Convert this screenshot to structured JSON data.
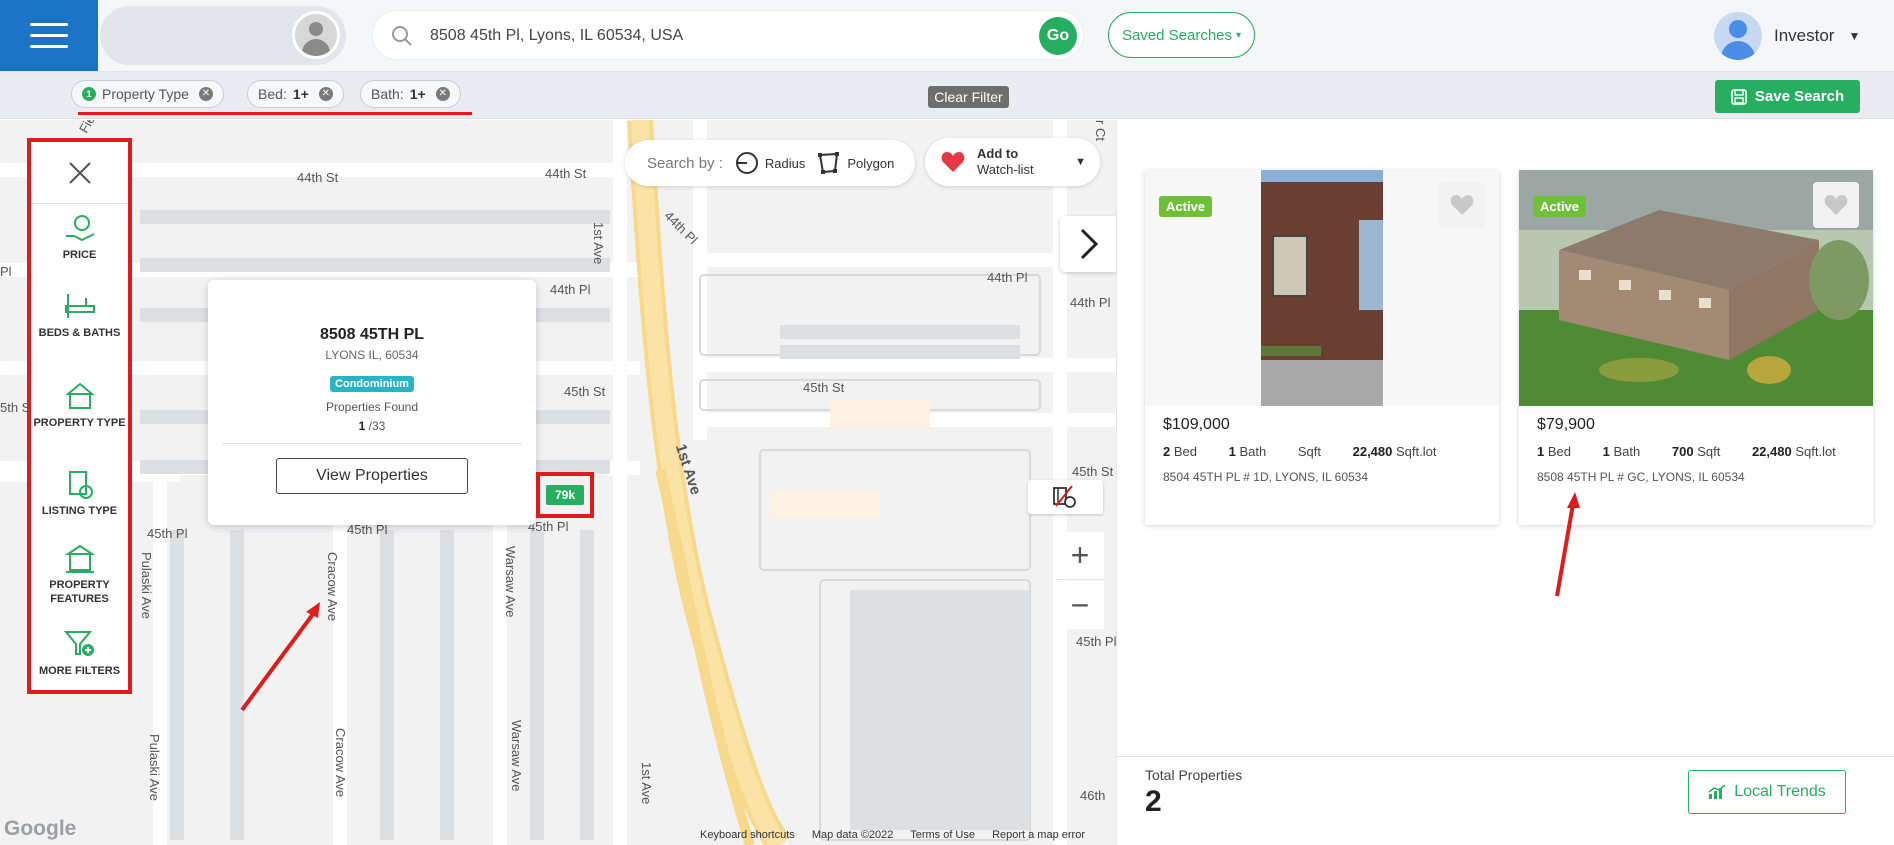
{
  "header": {
    "search_value": "8508 45th Pl, Lyons, IL 60534, USA",
    "go_label": "Go",
    "saved_searches_label": "Saved Searches",
    "user_name": "Investor"
  },
  "filters": {
    "chips": [
      {
        "badge": "1",
        "label": "Property Type",
        "value": ""
      },
      {
        "badge": "",
        "label": "Bed:",
        "value": "1+"
      },
      {
        "badge": "",
        "label": "Bath:",
        "value": "1+"
      }
    ],
    "clear_filter_label": "Clear Filter",
    "save_search_label": "Save Search"
  },
  "map": {
    "search_by_label": "Search by :",
    "radius_label": "Radius",
    "polygon_label": "Polygon",
    "watchlist_line1": "Add to",
    "watchlist_line2": "Watch-list",
    "street_labels": [
      "44th St",
      "44th St",
      "44th Pl",
      "44th Pl",
      "44th Pl",
      "45th St",
      "45th St",
      "45th Pl",
      "45th Pl",
      "45th Pl",
      "45th St",
      "45th Pl",
      "46th",
      "1st Ave",
      "1st Ave",
      "1st Ave",
      "44th Pl",
      "Pulaski Ave",
      "Pulaski Ave",
      "Cracow Ave",
      "Cracow Ave",
      "Warsaw Ave",
      "Warsaw Ave",
      "Field",
      "Pl",
      "5th St",
      "r Ct"
    ],
    "popup": {
      "address": "8508 45TH PL",
      "city": "LYONS IL, 60534",
      "badge": "Condominium",
      "found_label": "Properties Found",
      "found_current": "1",
      "found_total": "/33",
      "view_button": "View Properties"
    },
    "price_marker": "79k",
    "footer": [
      "Keyboard shortcuts",
      "Map data ©2022",
      "Terms of Use",
      "Report a map error"
    ],
    "google_logo": "Google"
  },
  "filter_sidebar": {
    "items": [
      "PRICE",
      "BEDS & BATHS",
      "PROPERTY TYPE",
      "LISTING TYPE",
      "PROPERTY FEATURES",
      "MORE FILTERS"
    ]
  },
  "listings": [
    {
      "status": "Active",
      "price": "$109,000",
      "beds": "2",
      "bed_label": "Bed",
      "baths": "1",
      "bath_label": "Bath",
      "sqft": "",
      "sqft_label": "Sqft",
      "lot": "22,480",
      "lot_label": "Sqft.lot",
      "address": "8504 45TH PL # 1D, LYONS, IL 60534"
    },
    {
      "status": "Active",
      "price": "$79,900",
      "beds": "1",
      "bed_label": "Bed",
      "baths": "1",
      "bath_label": "Bath",
      "sqft": "700",
      "sqft_label": "Sqft",
      "lot": "22,480",
      "lot_label": "Sqft.lot",
      "address": "8508 45TH PL # GC, LYONS, IL 60534"
    }
  ],
  "summary": {
    "total_label": "Total Properties",
    "total_value": "2",
    "local_trends_label": "Local Trends"
  },
  "colors": {
    "brand_blue": "#1a73c4",
    "accent_green": "#27ae60",
    "annotation_red": "#e01b1b",
    "status_green": "#6fbf3b",
    "condo_badge": "#2ab3c4"
  }
}
